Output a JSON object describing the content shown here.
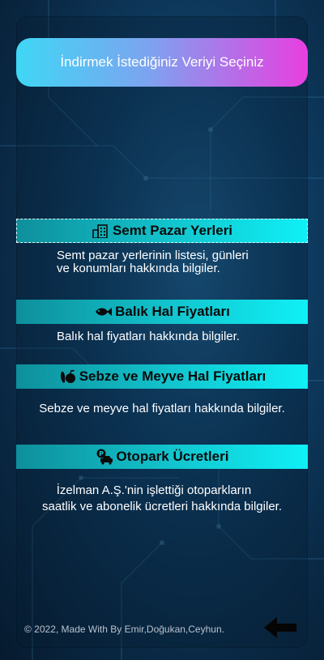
{
  "header": {
    "title": "İndirmek İstediğiniz Veriyi Seçiniz"
  },
  "sections": [
    {
      "title": "Semt Pazar Yerleri",
      "icon": "building-icon",
      "description_lines": [
        "Semt pazar yerlerinin listesi, günleri",
        "ve konumları hakkında bilgiler."
      ]
    },
    {
      "title": "Balık Hal Fiyatları",
      "icon": "fish-icon",
      "description_lines": [
        "Balık hal fiyatları hakkında bilgiler."
      ]
    },
    {
      "title": "Sebze ve Meyve Hal Fiyatları",
      "icon": "fruit-icon",
      "description_lines": [
        "Sebze ve meyve hal fiyatları hakkında bilgiler."
      ]
    },
    {
      "title": "Otopark Ücretleri",
      "icon": "parking-icon",
      "description_lines": [
        "İzelman A.Ş.'nin işlettiği otoparkların",
        "saatlik ve abonelik ücretleri hakkında bilgiler."
      ]
    }
  ],
  "footer": {
    "text": "© 2022, Made With By Emir,Doğukan,Ceyhun."
  },
  "colors": {
    "header_gradient_start": "#3fd7f5",
    "header_gradient_end": "#e83fe0",
    "section_bar": "#12c6cf",
    "background": "#0f3f66"
  }
}
